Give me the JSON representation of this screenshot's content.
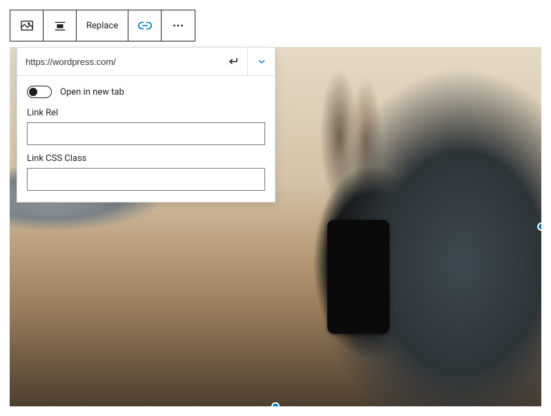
{
  "toolbar": {
    "replace_label": "Replace"
  },
  "link": {
    "url_value": "https://wordpress.com/",
    "open_new_tab_label": "Open in new tab",
    "open_new_tab_value": false,
    "link_rel_label": "Link Rel",
    "link_rel_value": "",
    "link_css_label": "Link CSS Class",
    "link_css_value": ""
  },
  "colors": {
    "accent": "#007cba"
  }
}
